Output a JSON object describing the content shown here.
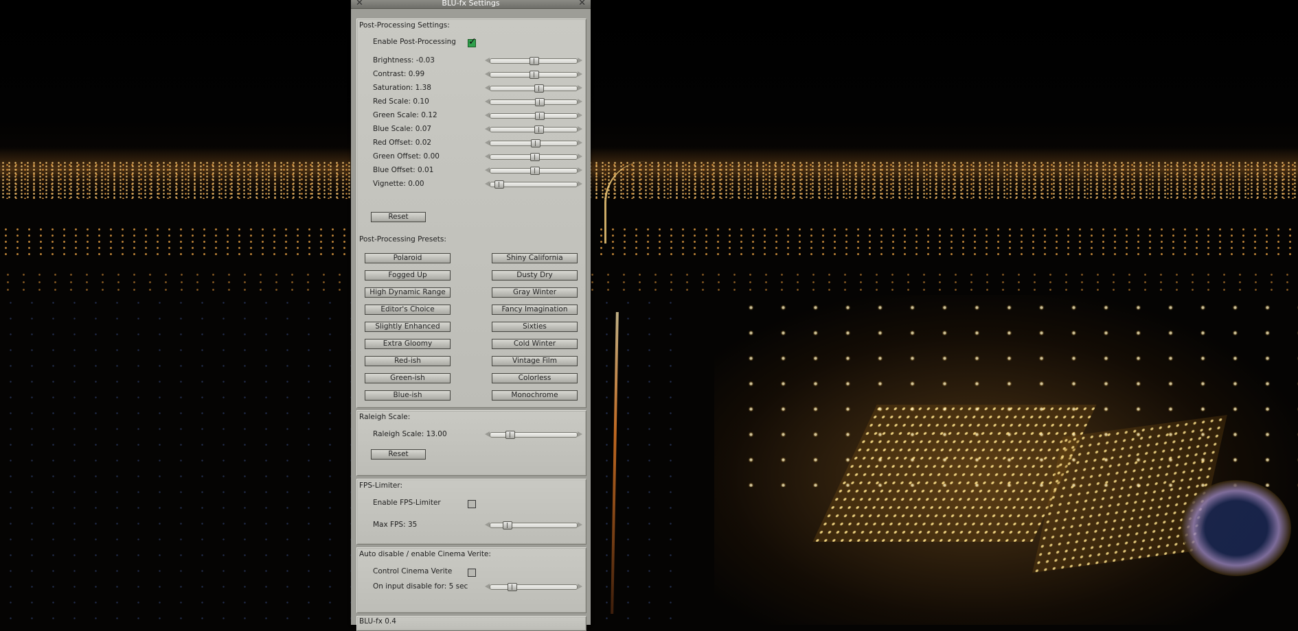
{
  "window": {
    "title": "BLU-fx Settings",
    "close_glyph": "✕",
    "pin_glyph": "✕"
  },
  "post_processing": {
    "label": "Post-Processing Settings:",
    "enable_label": "Enable Post-Processing",
    "enabled": true,
    "sliders": [
      {
        "label": "Brightness: -0.03",
        "position": 0.5
      },
      {
        "label": "Contrast: 0.99",
        "position": 0.5
      },
      {
        "label": "Saturation: 1.38",
        "position": 0.56
      },
      {
        "label": "Red Scale: 0.10",
        "position": 0.57
      },
      {
        "label": "Green Scale: 0.12",
        "position": 0.57
      },
      {
        "label": "Blue Scale: 0.07",
        "position": 0.56
      },
      {
        "label": "Red Offset: 0.02",
        "position": 0.52
      },
      {
        "label": "Green Offset: 0.00",
        "position": 0.51
      },
      {
        "label": "Blue Offset: 0.01",
        "position": 0.51
      },
      {
        "label": "Vignette: 0.00",
        "position": 0.06
      }
    ],
    "reset_label": "Reset"
  },
  "presets": {
    "label": "Post-Processing Presets:",
    "left": [
      "Polaroid",
      "Fogged Up",
      "High Dynamic Range",
      "Editor's Choice",
      "Slightly Enhanced",
      "Extra Gloomy",
      "Red-ish",
      "Green-ish",
      "Blue-ish"
    ],
    "right": [
      "Shiny California",
      "Dusty Dry",
      "Gray Winter",
      "Fancy Imagination",
      "Sixties",
      "Cold Winter",
      "Vintage Film",
      "Colorless",
      "Monochrome"
    ]
  },
  "raleigh": {
    "label": "Raleigh Scale:",
    "slider_label": "Raleigh Scale: 13.00",
    "position": 0.2,
    "reset_label": "Reset"
  },
  "fps": {
    "label": "FPS-Limiter:",
    "enable_label": "Enable FPS-Limiter",
    "enabled": false,
    "slider_label": "Max FPS: 35",
    "position": 0.16
  },
  "cinema": {
    "label": "Auto disable / enable Cinema Verite:",
    "control_label": "Control Cinema Verite",
    "enabled": false,
    "slider_label": "On input disable for: 5 sec",
    "position": 0.22
  },
  "footer": {
    "version": "BLU-fx 0.4"
  }
}
